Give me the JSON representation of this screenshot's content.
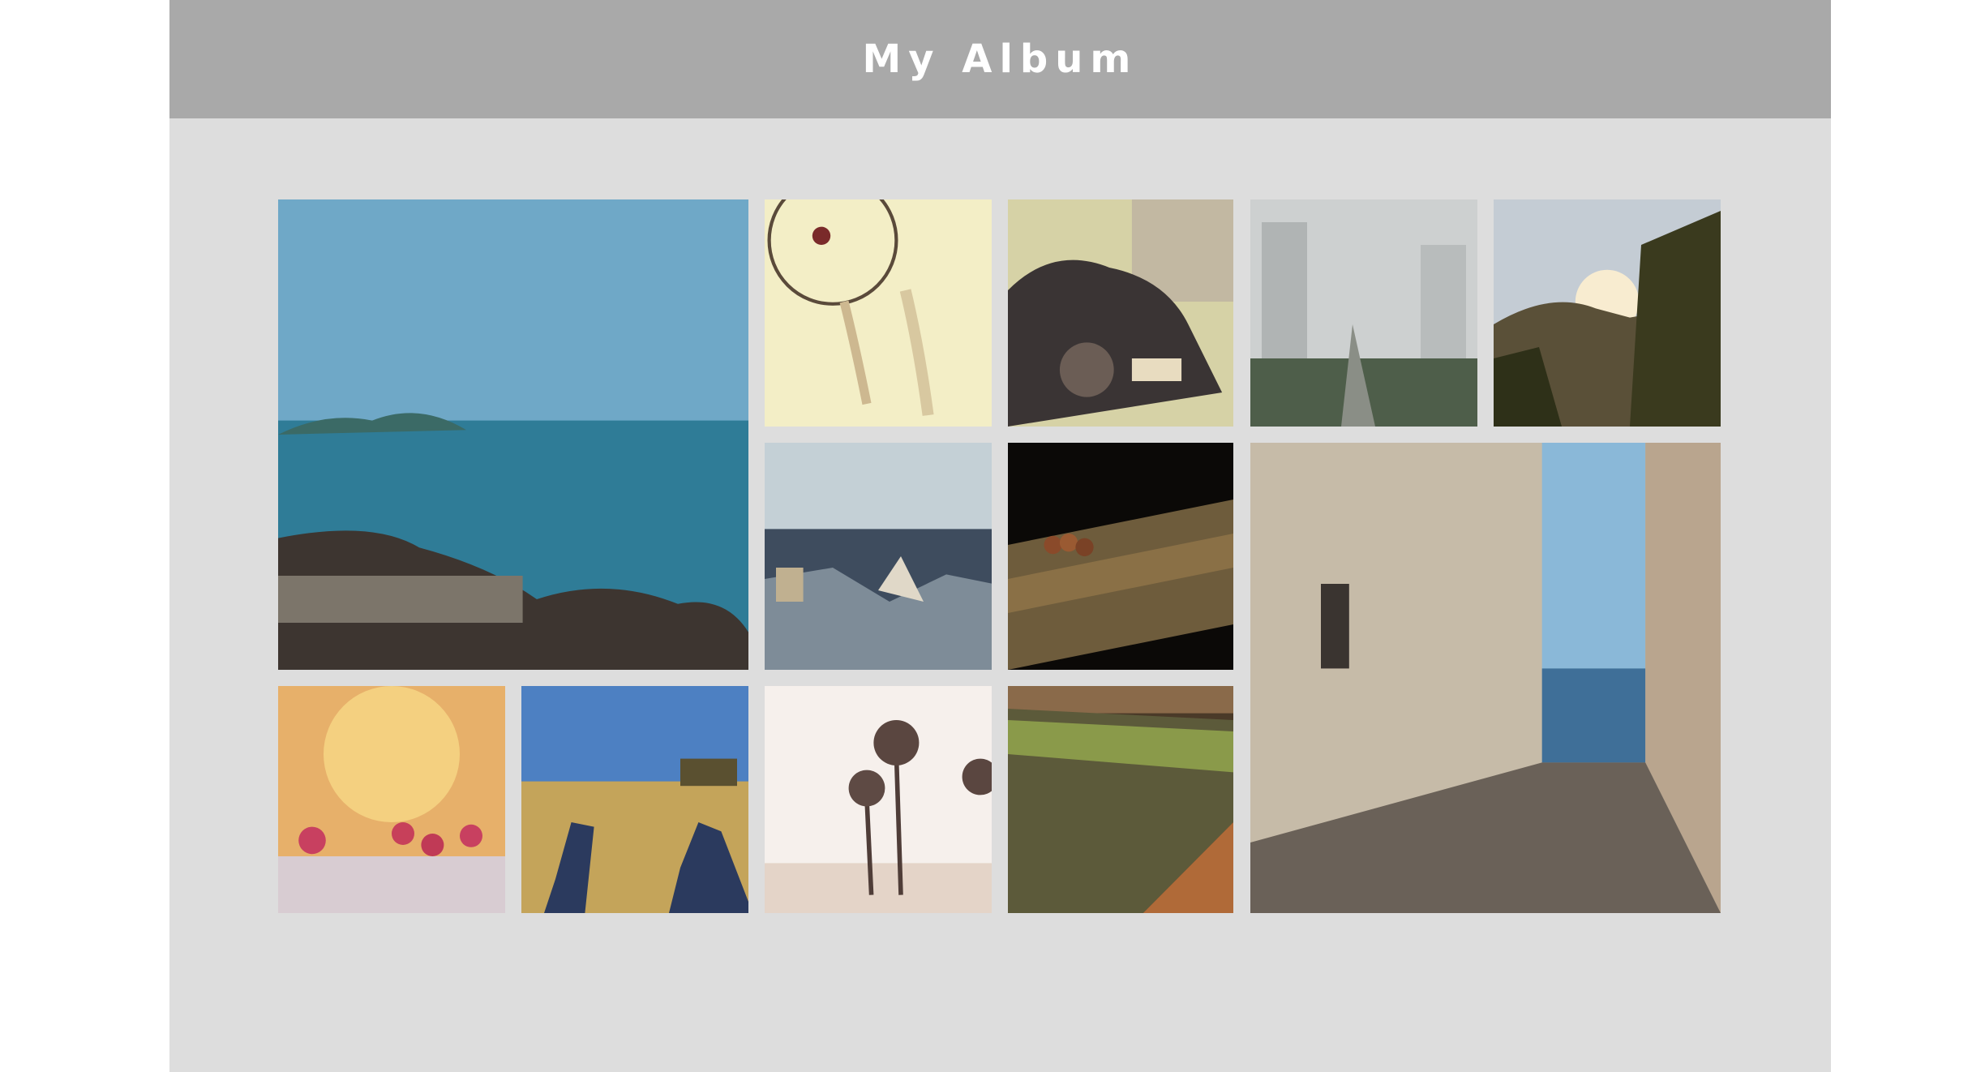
{
  "album": {
    "title": "My Album"
  },
  "photos": [
    {
      "name": "sea-with-rocks",
      "colors": [
        "#6fa8c7",
        "#2f7c97",
        "#3d3530"
      ]
    },
    {
      "name": "dreamcatcher",
      "colors": [
        "#f5f0c8",
        "#e9dfb0",
        "#5a4a3a"
      ]
    },
    {
      "name": "vintage-car",
      "colors": [
        "#d8d4a0",
        "#3a3434",
        "#6b5d55"
      ]
    },
    {
      "name": "rain-on-window",
      "colors": [
        "#cfd2d2",
        "#9aa3a2",
        "#4e5e4a"
      ]
    },
    {
      "name": "mountain-sunset",
      "colors": [
        "#c8d2dc",
        "#f4e8c8",
        "#3e3a22"
      ]
    },
    {
      "name": "city-rooftops",
      "colors": [
        "#b7c6cf",
        "#5d6e80",
        "#2a3444"
      ]
    },
    {
      "name": "seed-pod-on-wood",
      "colors": [
        "#0b0907",
        "#6b5a3a",
        "#a07a4a"
      ]
    },
    {
      "name": "narrow-alley-to-sea",
      "colors": [
        "#8ab8d8",
        "#c0b7a6",
        "#6c6258"
      ]
    },
    {
      "name": "raspberries",
      "colors": [
        "#f0c060",
        "#e3a57a",
        "#c7405a"
      ]
    },
    {
      "name": "sneakers-on-field",
      "colors": [
        "#4f7fc0",
        "#c4a45a",
        "#2b3a5e"
      ]
    },
    {
      "name": "palm-trees",
      "colors": [
        "#f7f1ec",
        "#ecdcd4",
        "#4f3d38"
      ]
    },
    {
      "name": "mossy-log",
      "colors": [
        "#8a7a4a",
        "#5a5a32",
        "#b06a38"
      ]
    }
  ]
}
